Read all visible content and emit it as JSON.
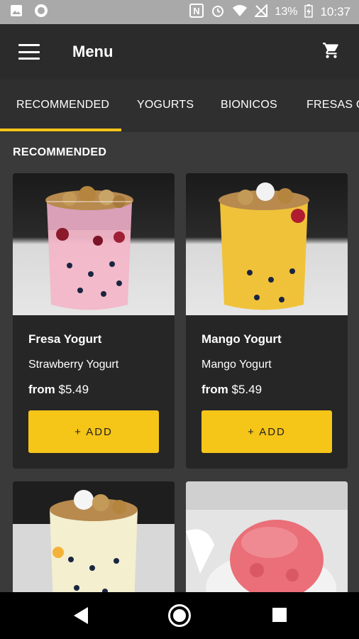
{
  "status_bar": {
    "battery": "13%",
    "time": "10:37",
    "icons": [
      "image-icon",
      "circle-notification-icon",
      "nfc-icon",
      "alarm-icon",
      "wifi-icon",
      "no-signal-icon",
      "battery-charging-icon"
    ]
  },
  "app_bar": {
    "title": "Menu",
    "icons": [
      "hamburger-menu-icon",
      "shopping-cart-icon"
    ]
  },
  "tabs": [
    {
      "label": "RECOMMENDED",
      "active": true
    },
    {
      "label": "YOGURTS",
      "active": false
    },
    {
      "label": "BIONICOS",
      "active": false
    },
    {
      "label": "FRESAS C",
      "active": false
    }
  ],
  "section": {
    "title": "RECOMMENDED"
  },
  "products": [
    {
      "name": "Fresa Yogurt",
      "description": "Strawberry Yogurt",
      "price_prefix": "from",
      "price": "$5.49",
      "add_label": "+ ADD"
    },
    {
      "name": "Mango Yogurt",
      "description": "Mango Yogurt",
      "price_prefix": "from",
      "price": "$5.49",
      "add_label": "+ ADD"
    },
    {
      "name": "",
      "description": "",
      "price_prefix": "",
      "price": "",
      "add_label": ""
    },
    {
      "name": "",
      "description": "",
      "price_prefix": "",
      "price": "",
      "add_label": ""
    }
  ],
  "colors": {
    "accent": "#f5c518",
    "app_bar": "#2b2b2b",
    "tabs_bg": "#2f2f2f",
    "content_bg": "#3a3a3a",
    "card_bg": "#262626",
    "status_bar": "#a9a9a9"
  },
  "nav_bar": {
    "icons": [
      "back-triangle-icon",
      "home-circle-icon",
      "recents-square-icon"
    ]
  }
}
